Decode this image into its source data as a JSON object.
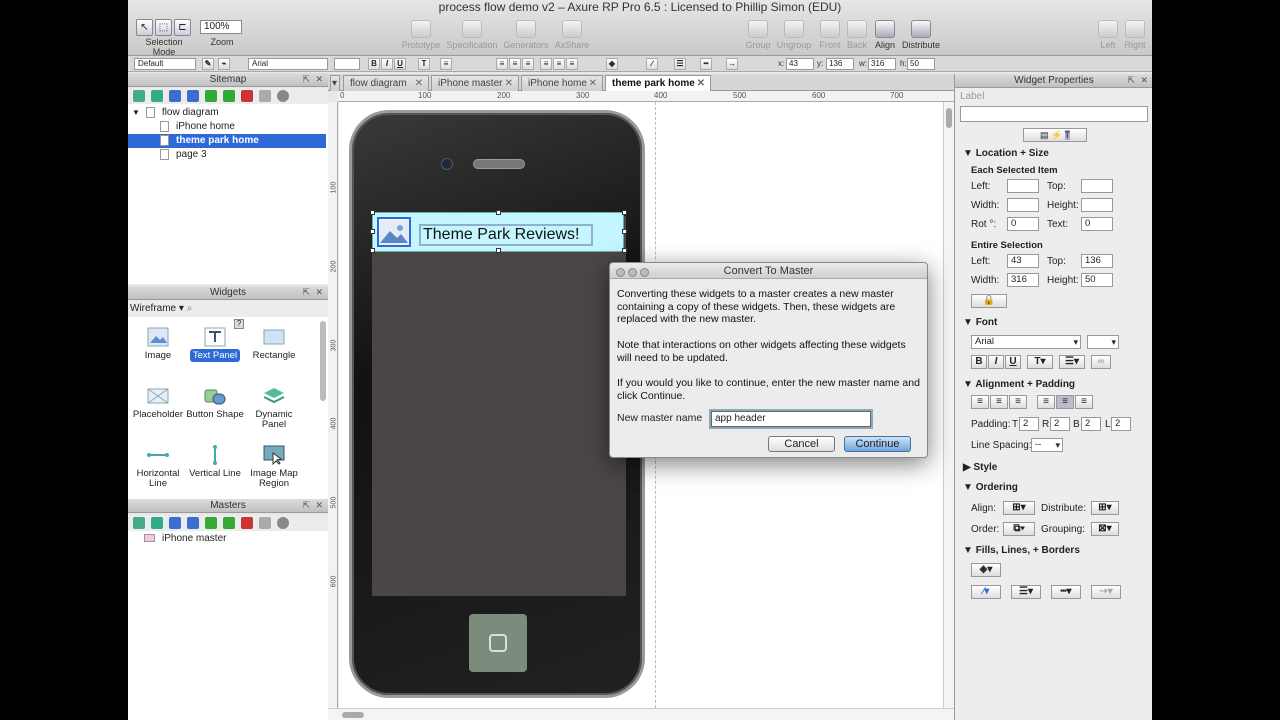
{
  "window": {
    "title": "process flow demo v2 – Axure RP Pro 6.5 : Licensed to Phillip Simon (EDU)"
  },
  "toolbar": {
    "selection_mode": "Selection Mode",
    "zoom_label": "Zoom",
    "zoom_value": "100%",
    "prototype": "Prototype",
    "specification": "Specification",
    "generators": "Generators",
    "axshare": "AxShare",
    "group": "Group",
    "ungroup": "Ungroup",
    "front": "Front",
    "back": "Back",
    "align": "Align",
    "distribute": "Distribute",
    "left": "Left",
    "right": "Right"
  },
  "formatbar": {
    "style": "Default",
    "font": "Arial",
    "x_label": "x:",
    "x": "43",
    "y_label": "y:",
    "y": "136",
    "w_label": "w:",
    "w": "316",
    "h_label": "h:",
    "h": "50"
  },
  "sitemap": {
    "title": "Sitemap",
    "items": [
      {
        "label": "flow diagram"
      },
      {
        "label": "iPhone home"
      },
      {
        "label": "theme park home"
      },
      {
        "label": "page 3"
      }
    ]
  },
  "widgets": {
    "title": "Widgets",
    "library": "Wireframe",
    "items": [
      {
        "label": "Image"
      },
      {
        "label": "Text Panel"
      },
      {
        "label": "Rectangle"
      },
      {
        "label": "Placeholder"
      },
      {
        "label": "Button Shape"
      },
      {
        "label": "Dynamic Panel"
      },
      {
        "label": "Horizontal Line"
      },
      {
        "label": "Vertical Line"
      },
      {
        "label": "Image Map Region"
      }
    ]
  },
  "masters": {
    "title": "Masters",
    "items": [
      {
        "label": "iPhone master"
      }
    ]
  },
  "tabs": [
    {
      "label": "flow diagram"
    },
    {
      "label": "iPhone master"
    },
    {
      "label": "iPhone home"
    },
    {
      "label": "theme park home"
    }
  ],
  "ruler": {
    "h": [
      "0",
      "100",
      "200",
      "300",
      "400",
      "500",
      "600",
      "700"
    ],
    "v": [
      "100",
      "200",
      "300",
      "400",
      "500",
      "600"
    ]
  },
  "canvas": {
    "header_text": "Theme Park Reviews!"
  },
  "dialog": {
    "title": "Convert To Master",
    "p1": "Converting these widgets to a master creates a new master containing a copy of these widgets. Then, these widgets are replaced with the new master.",
    "p2": "Note that interactions on other widgets affecting these widgets will need to be updated.",
    "p3": "If you would you like to continue, enter the new master name and click Continue.",
    "field_label": "New master name",
    "field_value": "app header",
    "cancel": "Cancel",
    "continue": "Continue"
  },
  "props": {
    "title": "Widget Properties",
    "label_field": "Label",
    "location_size": "Location + Size",
    "each_selected": "Each Selected Item",
    "left": "Left:",
    "top": "Top:",
    "width": "Width:",
    "height": "Height:",
    "rot": "Rot °:",
    "rot_val": "0",
    "text": "Text:",
    "text_val": "0",
    "entire_selection": "Entire Selection",
    "left_val": "43",
    "top_val": "136",
    "width_val": "316",
    "height_val": "50",
    "font": "Font",
    "font_name": "Arial",
    "alignment_padding": "Alignment + Padding",
    "padding": "Padding:",
    "pad_t": "T",
    "pad_t_val": "2",
    "pad_r": "R",
    "pad_r_val": "2",
    "pad_b": "B",
    "pad_b_val": "2",
    "pad_l": "L",
    "pad_l_val": "2",
    "line_spacing": "Line Spacing:",
    "line_spacing_val": "--",
    "style": "Style",
    "ordering": "Ordering",
    "align": "Align:",
    "distribute": "Distribute:",
    "order": "Order:",
    "grouping": "Grouping:",
    "fills": "Fills, Lines, + Borders"
  }
}
